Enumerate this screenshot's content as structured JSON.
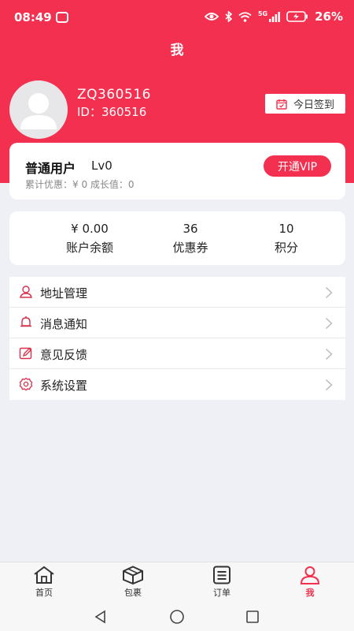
{
  "status_bar": {
    "time": "08:49",
    "network": "5G",
    "battery": "26%"
  },
  "page_title": "我",
  "profile": {
    "username": "ZQ360516",
    "user_id": "ID：360516",
    "signin_label": "今日签到"
  },
  "membership": {
    "level_name": "普通用户",
    "level": "Lv0",
    "summary": "累计优惠：¥ 0 成长值：0",
    "vip_button": "开通VIP"
  },
  "stats": [
    {
      "value": "¥ 0.00",
      "label": "账户余额"
    },
    {
      "value": "36",
      "label": "优惠券"
    },
    {
      "value": "10",
      "label": "积分"
    }
  ],
  "menu": [
    {
      "label": "地址管理",
      "icon": "address-icon"
    },
    {
      "label": "消息通知",
      "icon": "bell-icon"
    },
    {
      "label": "意见反馈",
      "icon": "feedback-icon"
    },
    {
      "label": "系统设置",
      "icon": "settings-icon"
    }
  ],
  "tabs": [
    {
      "label": "首页",
      "icon": "home-icon"
    },
    {
      "label": "包裹",
      "icon": "package-icon"
    },
    {
      "label": "订单",
      "icon": "order-icon"
    },
    {
      "label": "我",
      "icon": "profile-icon",
      "active": true
    }
  ],
  "colors": {
    "accent": "#f3304f",
    "background": "#eef0f5"
  }
}
